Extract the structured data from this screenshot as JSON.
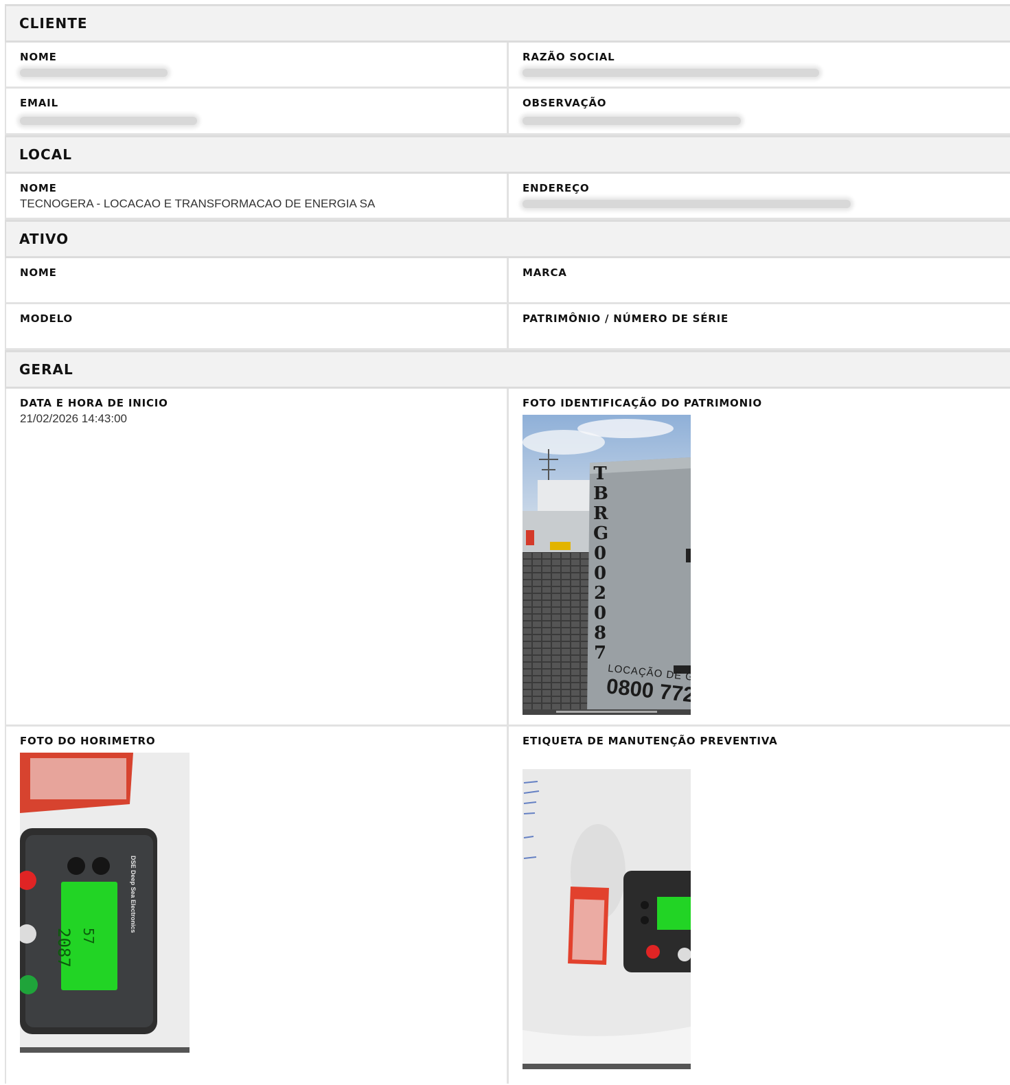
{
  "cliente": {
    "title": "CLIENTE",
    "nome_label": "NOME",
    "razao_label": "RAZÃO SOCIAL",
    "email_label": "EMAIL",
    "obs_label": "OBSERVAÇÃO"
  },
  "local": {
    "title": "LOCAL",
    "nome_label": "NOME",
    "nome_value": "TECNOGERA - LOCACAO E TRANSFORMACAO DE ENERGIA SA",
    "endereco_label": "ENDEREÇO"
  },
  "ativo": {
    "title": "ATIVO",
    "nome_label": "NOME",
    "marca_label": "MARCA",
    "modelo_label": "MODELO",
    "patrimonio_label": "PATRIMÔNIO / NÚMERO DE SÉRIE"
  },
  "geral": {
    "title": "GERAL",
    "inicio_label": "DATA E HORA DE INICIO",
    "inicio_value": "21/02/2026 14:43:00",
    "foto_patrimonio_label": "FOTO IDENTIFICAÇÃO DO PATRIMONIO",
    "foto_horimetro_label": "FOTO DO HORIMETRO",
    "etiqueta_label": "ETIQUETA DE MANUTENÇÃO PREVENTIVA"
  },
  "photo_text": {
    "serial_stencil": "TBRG002087",
    "phone": "0800 772",
    "locacao": "LOCAÇÃO DE GE",
    "hours": "2087",
    "minutes": "57",
    "dse": "DSE Deep Sea Electronics"
  }
}
